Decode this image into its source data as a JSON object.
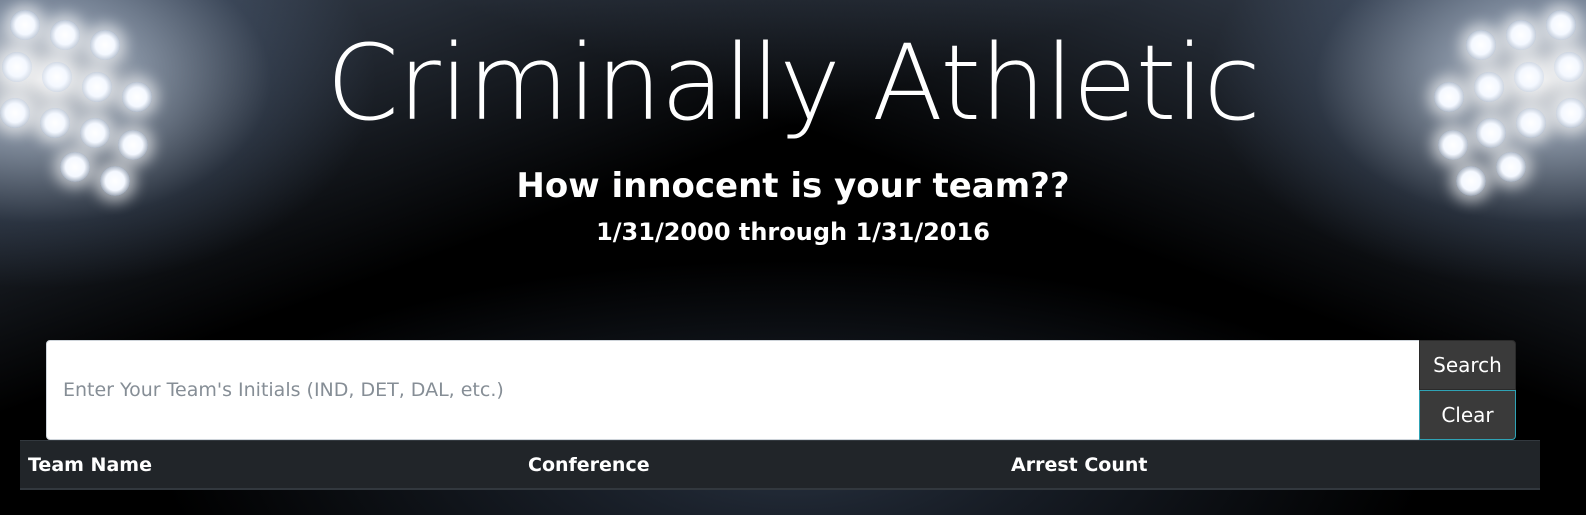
{
  "header": {
    "title": "Criminally Athletic",
    "subtitle": "How innocent is your team??",
    "date_range": "1/31/2000 through 1/31/2016"
  },
  "search": {
    "placeholder": "Enter Your Team's Initials (IND, DET, DAL, etc.)",
    "value": "",
    "search_label": "Search",
    "clear_label": "Clear"
  },
  "table": {
    "columns": [
      "Team Name",
      "Conference",
      "Arrest Count"
    ]
  },
  "colors": {
    "background": "#000000",
    "button": "#3a3a3a",
    "table_header": "#212529",
    "clear_border": "#2fa3b5"
  }
}
